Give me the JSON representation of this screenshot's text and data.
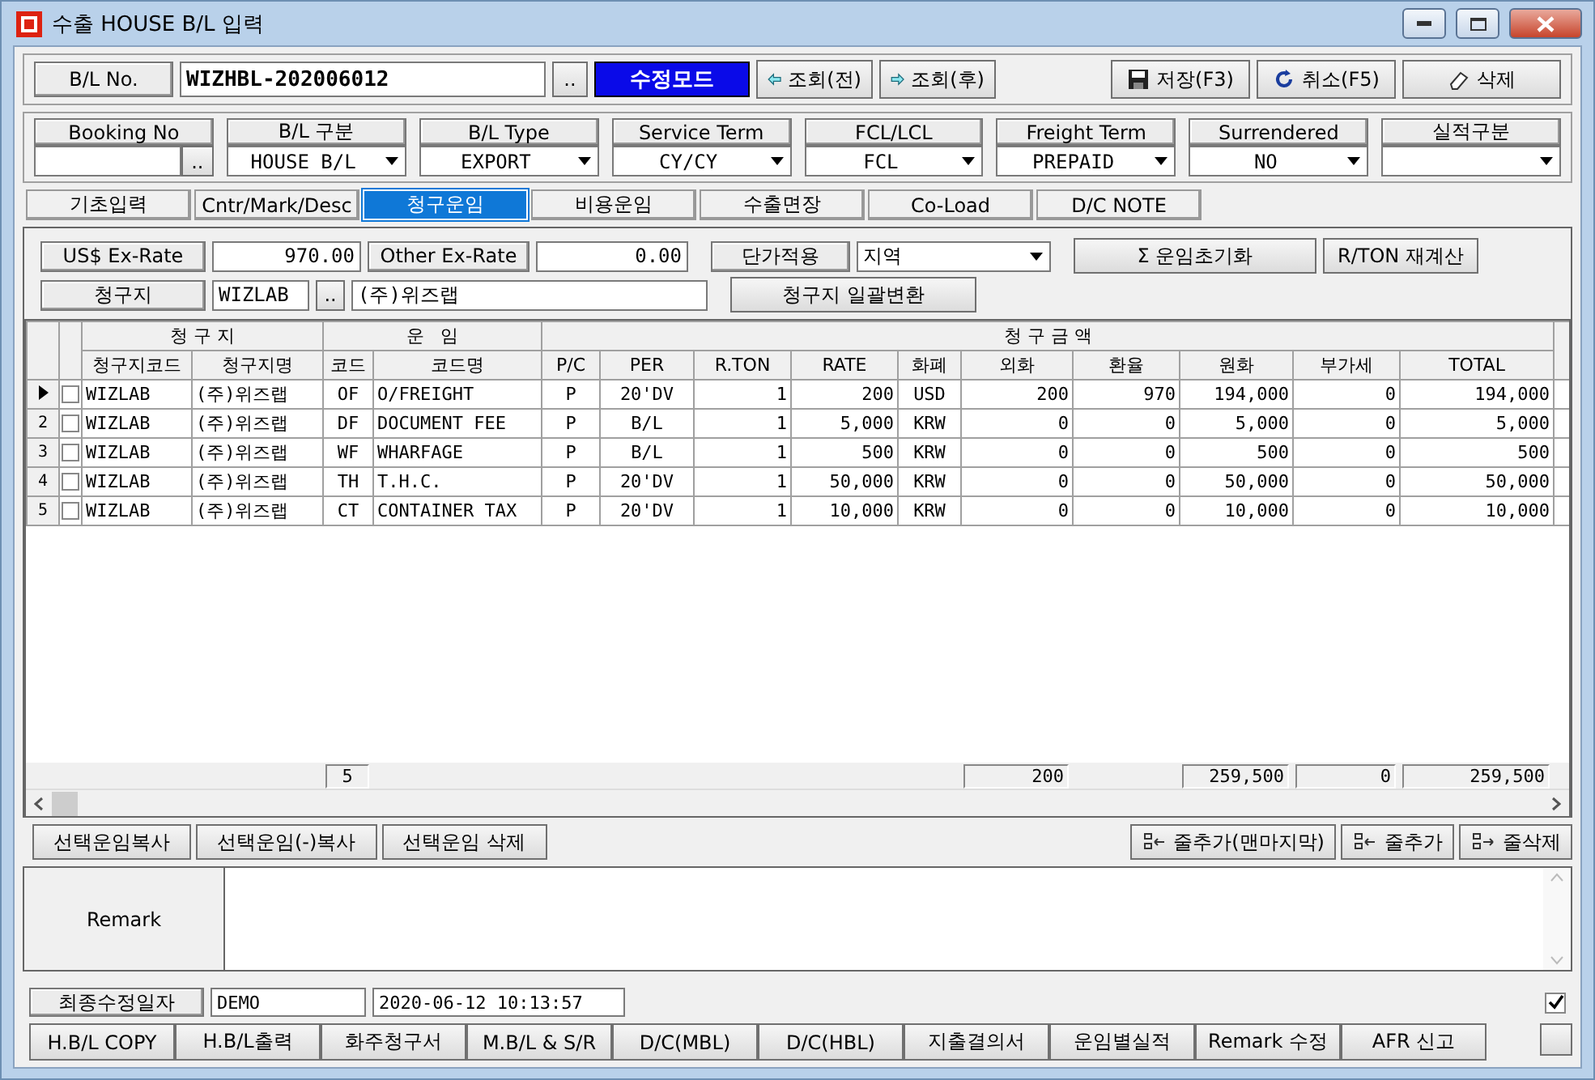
{
  "window": {
    "title": "수출 HOUSE B/L 입력"
  },
  "header": {
    "bl_no_label": "B/L No.",
    "bl_no": "WIZHBL-202006012",
    "lookup_button": "..",
    "mode_badge": "수정모드",
    "nav": [
      {
        "kind": "prev",
        "label": "조회(전)"
      },
      {
        "kind": "next",
        "label": "조회(후)"
      }
    ],
    "actions": [
      {
        "kind": "save",
        "label": "저장(F3)"
      },
      {
        "kind": "cancel",
        "label": "취소(F5)"
      },
      {
        "kind": "delete",
        "label": "삭제"
      }
    ]
  },
  "fields": [
    {
      "label": "Booking No",
      "kind": "lookup",
      "button": ".."
    },
    {
      "label": "B/L 구분",
      "kind": "select",
      "value": "HOUSE B/L"
    },
    {
      "label": "B/L Type",
      "kind": "select",
      "value": "EXPORT"
    },
    {
      "label": "Service Term",
      "kind": "select",
      "value": "CY/CY"
    },
    {
      "label": "FCL/LCL",
      "kind": "select",
      "value": "FCL"
    },
    {
      "label": "Freight Term",
      "kind": "select",
      "value": "PREPAID"
    },
    {
      "label": "Surrendered",
      "kind": "select",
      "value": "NO"
    },
    {
      "label": "실적구분",
      "kind": "select"
    }
  ],
  "tabs": [
    {
      "label": "기초입력",
      "selected": false
    },
    {
      "label": "Cntr/Mark/Desc",
      "selected": false
    },
    {
      "label": "청구운임",
      "selected": true
    },
    {
      "label": "비용운임",
      "selected": false
    },
    {
      "label": "수출면장",
      "selected": false
    },
    {
      "label": "Co-Load",
      "selected": false
    },
    {
      "label": "D/C NOTE",
      "selected": false
    }
  ],
  "rates": {
    "usd_label": "US$ Ex-Rate",
    "usd_value": "970.00",
    "other_label": "Other Ex-Rate",
    "other_value": "0.00",
    "price_label": "단가적용",
    "price_value": "지역",
    "reset_button": "Σ 운임초기화",
    "rton_button": "R/TON 재계산",
    "billto_label": "청구지",
    "billto_code": "WIZLAB",
    "billto_lookup": "..",
    "billto_name": "(주)위즈랩",
    "billto_convert_button": "청구지 일괄변환"
  },
  "grid": {
    "groups": [
      {
        "label": "청 구 지",
        "columns": [
          {
            "label": "청구지코드",
            "kind": "text"
          },
          {
            "label": "청구지명",
            "kind": "text"
          }
        ]
      },
      {
        "label": "운   임",
        "columns": [
          {
            "label": "코드",
            "kind": "code",
            "total": "5"
          },
          {
            "label": "코드명",
            "kind": "text"
          }
        ]
      },
      {
        "label": "청 구 금 액",
        "columns": [
          {
            "label": "P/C",
            "kind": "code"
          },
          {
            "label": "PER",
            "kind": "code"
          },
          {
            "label": "R.TON",
            "kind": "number"
          },
          {
            "label": "RATE",
            "kind": "number"
          },
          {
            "label": "화폐",
            "kind": "code"
          },
          {
            "label": "외화",
            "kind": "number",
            "total": "200"
          },
          {
            "label": "환율",
            "kind": "number"
          },
          {
            "label": "원화",
            "kind": "number",
            "total": "259,500"
          },
          {
            "label": "부가세",
            "kind": "number",
            "total": "0"
          },
          {
            "label": "TOTAL",
            "kind": "number",
            "total": "259,500"
          }
        ]
      }
    ],
    "rows": [
      {
        "current": true,
        "checked": false,
        "cells": [
          "WIZLAB",
          "(주)위즈랩",
          "OF",
          "O/FREIGHT",
          "P",
          "20'DV",
          "1",
          "200",
          "USD",
          "200",
          "970",
          "194,000",
          "0",
          "194,000"
        ]
      },
      {
        "number": "2",
        "current": false,
        "checked": false,
        "cells": [
          "WIZLAB",
          "(주)위즈랩",
          "DF",
          "DOCUMENT FEE",
          "P",
          "B/L",
          "1",
          "5,000",
          "KRW",
          "0",
          "0",
          "5,000",
          "0",
          "5,000"
        ]
      },
      {
        "number": "3",
        "current": false,
        "checked": false,
        "cells": [
          "WIZLAB",
          "(주)위즈랩",
          "WF",
          "WHARFAGE",
          "P",
          "B/L",
          "1",
          "500",
          "KRW",
          "0",
          "0",
          "500",
          "0",
          "500"
        ]
      },
      {
        "number": "4",
        "current": false,
        "checked": false,
        "cells": [
          "WIZLAB",
          "(주)위즈랩",
          "TH",
          "T.H.C.",
          "P",
          "20'DV",
          "1",
          "50,000",
          "KRW",
          "0",
          "0",
          "50,000",
          "0",
          "50,000"
        ]
      },
      {
        "number": "5",
        "current": false,
        "checked": false,
        "cells": [
          "WIZLAB",
          "(주)위즈랩",
          "CT",
          "CONTAINER TAX",
          "P",
          "20'DV",
          "1",
          "10,000",
          "KRW",
          "0",
          "0",
          "10,000",
          "0",
          "10,000"
        ]
      }
    ]
  },
  "row_actions_left": [
    "선택운임복사",
    "선택운임(-)복사",
    "선택운임 삭제"
  ],
  "row_actions_right": [
    {
      "kind": "add",
      "label": "줄추가(맨마지막)"
    },
    {
      "kind": "add",
      "label": "줄추가"
    },
    {
      "kind": "remove",
      "label": "줄삭제"
    }
  ],
  "remark": {
    "label": "Remark"
  },
  "modified": {
    "label": "최종수정일자",
    "user": "DEMO",
    "time": "2020-06-12 10:13:57",
    "checked": true
  },
  "bottom_buttons": [
    "H.B/L COPY",
    "H.B/L출력",
    "화주청구서",
    "M.B/L & S/R",
    "D/C(MBL)",
    "D/C(HBL)",
    "지출결의서",
    "운임별실적",
    "Remark 수정",
    "AFR 신고"
  ]
}
